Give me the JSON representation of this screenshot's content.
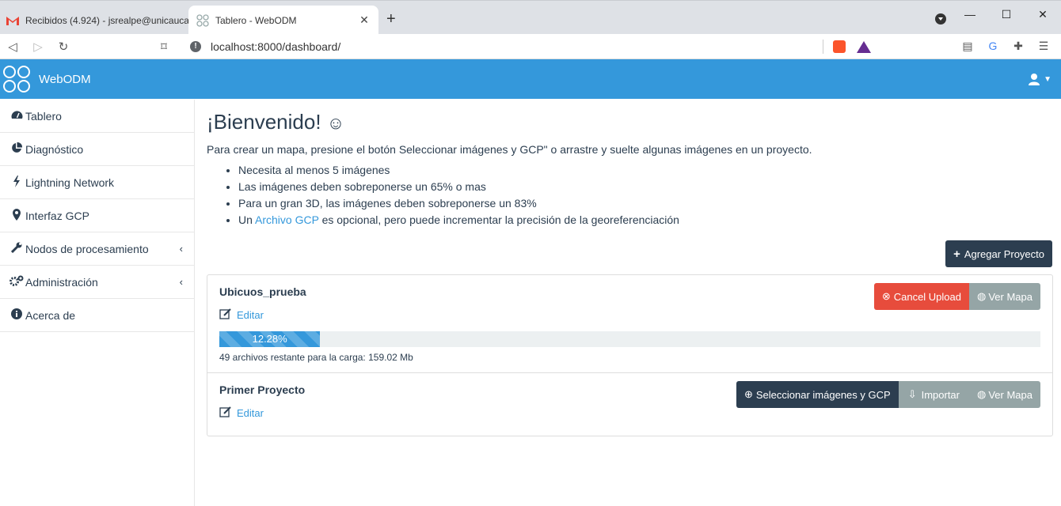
{
  "browser": {
    "tabs": [
      {
        "title": "Recibidos (4.924) - jsrealpe@unicauca",
        "favicon": "gmail-icon"
      },
      {
        "title": "Tablero - WebODM",
        "favicon": "webodm-icon"
      }
    ],
    "url": "localhost:8000/dashboard/"
  },
  "app": {
    "brand": "WebODM"
  },
  "sidebar": {
    "items": [
      {
        "label": "Tablero",
        "icon": "dashboard-icon"
      },
      {
        "label": "Diagnóstico",
        "icon": "pie-chart-icon"
      },
      {
        "label": "Lightning Network",
        "icon": "bolt-icon"
      },
      {
        "label": "Interfaz GCP",
        "icon": "map-marker-icon"
      },
      {
        "label": "Nodos de procesamiento",
        "icon": "wrench-icon"
      },
      {
        "label": "Administración",
        "icon": "cogs-icon"
      },
      {
        "label": "Acerca de",
        "icon": "info-icon"
      }
    ]
  },
  "welcome": {
    "title": "¡Bienvenido!",
    "intro": "Para crear un mapa, presione el botón Seleccionar imágenes y GCP\" o arrastre y suelte algunas imágenes en un proyecto.",
    "tips": [
      "Necesita al menos 5 imágenes",
      "Las imágenes deben sobreponerse un 65% o mas",
      "Para un gran 3D, las imágenes deben sobreponerse un 83%"
    ],
    "tip4_prefix": "Un ",
    "tip4_link": "Archivo GCP",
    "tip4_suffix": " es opcional, pero puede incrementar la precisión de la georeferenciación"
  },
  "add_project_label": "Agregar Proyecto",
  "projects": [
    {
      "name": "Ubicuos_prueba",
      "edit_label": "Editar",
      "cancel_label": "Cancel Upload",
      "map_label": "Ver Mapa",
      "progress_percent": 12.28,
      "progress_text": "12.28%",
      "remaining_text": "49 archivos restante para la carga: 159.02 Mb"
    },
    {
      "name": "Primer Proyecto",
      "edit_label": "Editar",
      "select_label": "Seleccionar imágenes y GCP",
      "import_label": "Importar",
      "map_label": "Ver Mapa"
    }
  ],
  "colors": {
    "header": "#3498db",
    "dark": "#2c3e50",
    "danger": "#e74c3c",
    "secondary": "#95a5a6"
  }
}
